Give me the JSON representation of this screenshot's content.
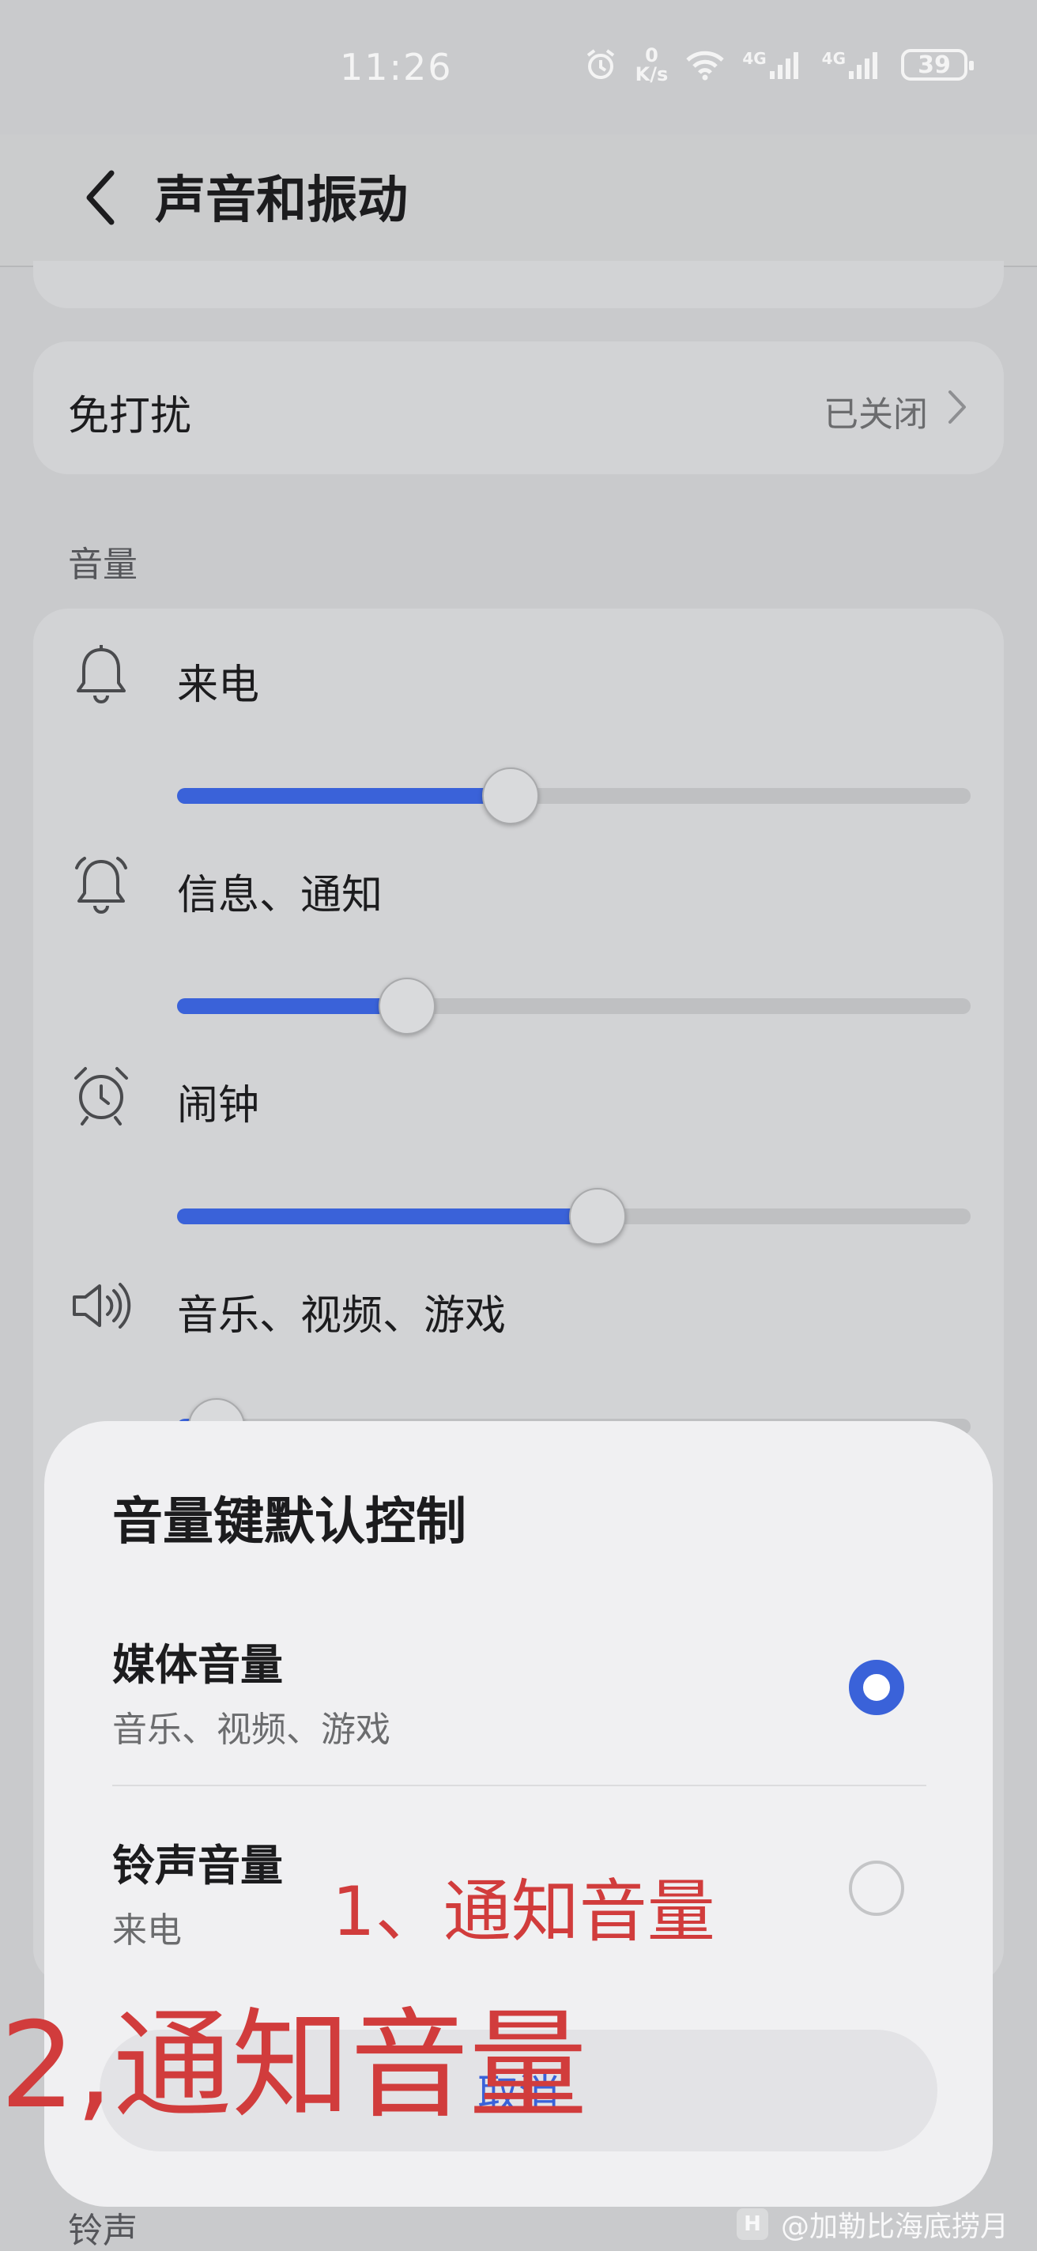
{
  "status_bar": {
    "time": "11:26",
    "net_speed_value": "0",
    "net_speed_unit": "K/s",
    "network_1": "4G",
    "network_2": "4G",
    "battery": "39"
  },
  "header": {
    "title": "声音和振动"
  },
  "dnd": {
    "label": "免打扰",
    "value": "已关闭"
  },
  "volume_section": {
    "label": "音量",
    "items": [
      {
        "label": "来电",
        "icon": "bell-icon",
        "level": 0.42
      },
      {
        "label": "信息、通知",
        "icon": "notification-bell-icon",
        "level": 0.29
      },
      {
        "label": "闹钟",
        "icon": "alarm-clock-icon",
        "level": 0.53
      },
      {
        "label": "音乐、视频、游戏",
        "icon": "speaker-icon",
        "level": 0.05
      }
    ]
  },
  "ringtone_section": {
    "label": "铃声"
  },
  "dialog": {
    "title": "音量键默认控制",
    "options": [
      {
        "title": "媒体音量",
        "subtitle": "音乐、视频、游戏",
        "checked": true
      },
      {
        "title": "铃声音量",
        "subtitle": "来电",
        "checked": false
      }
    ],
    "cancel_label": "取消"
  },
  "annotations": {
    "note_1": "1、通知音量",
    "note_2": "2,通知音量"
  },
  "watermark": {
    "text": "@加勒比海底捞月",
    "icon": "H"
  },
  "colors": {
    "accent": "#3a62d9",
    "annotation": "#d13c3c"
  }
}
